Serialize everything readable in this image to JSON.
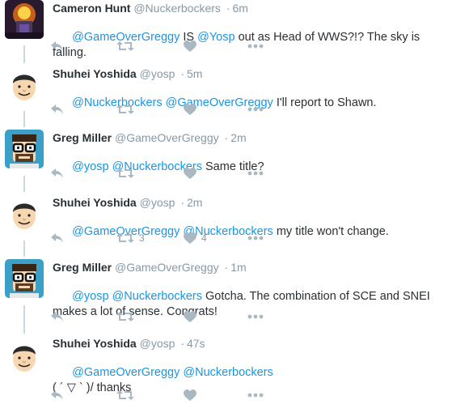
{
  "colors": {
    "link": "#1b95e0",
    "muted": "#8899a6",
    "action_icon": "#aab8c2",
    "text": "#292f33"
  },
  "icons": {
    "reply": "reply-icon",
    "retweet": "retweet-icon",
    "like": "heart-icon",
    "more": "more-icon"
  },
  "tweets": [
    {
      "name": "Cameron Hunt",
      "handle": "@Nuckerbockers",
      "sep": "·",
      "time": "6m",
      "avatar": "game-character-avatar",
      "mention1": "@GameOverGreggy",
      "t1": " IS ",
      "mention2": "@Yosp",
      "t2": " out as Head of WWS?!? The sky is falling.",
      "retweets": "",
      "likes": ""
    },
    {
      "name": "Shuhei Yoshida",
      "handle": "@yosp",
      "sep": "·",
      "time": "5m",
      "avatar": "cartoon-man-avatar",
      "mention1": "@Nuckerbockers",
      "t1": " ",
      "mention2": "@GameOverGreggy",
      "t2": " I'll report to Shawn.",
      "retweets": "",
      "likes": ""
    },
    {
      "name": "Greg Miller",
      "handle": "@GameOverGreggy",
      "sep": "·",
      "time": "2m",
      "avatar": "cartoon-glasses-avatar",
      "mention1": "@yosp",
      "t1": " ",
      "mention2": "@Nuckerbockers",
      "t2": " Same title?",
      "retweets": "",
      "likes": ""
    },
    {
      "name": "Shuhei Yoshida",
      "handle": "@yosp",
      "sep": "·",
      "time": "2m",
      "avatar": "cartoon-man-avatar",
      "mention1": "@GameOverGreggy",
      "t1": " ",
      "mention2": "@Nuckerbockers",
      "t2": " my title won't change.",
      "retweets": "3",
      "likes": "4"
    },
    {
      "name": "Greg Miller",
      "handle": "@GameOverGreggy",
      "sep": "·",
      "time": "1m",
      "avatar": "cartoon-glasses-avatar",
      "mention1": "@yosp",
      "t1": " ",
      "mention2": "@Nuckerbockers",
      "t2": " Gotcha. The combination of SCE and SNEI makes a lot of sense. Congrats!",
      "retweets": "",
      "likes": ""
    },
    {
      "name": "Shuhei Yoshida",
      "handle": "@yosp",
      "sep": "·",
      "time": "47s",
      "avatar": "cartoon-man-avatar",
      "mention1": "@GameOverGreggy",
      "t1": " ",
      "mention2": "@Nuckerbockers",
      "t2": "\n( ´ ▽ ` )/ thanks",
      "retweets": "",
      "likes": ""
    }
  ]
}
